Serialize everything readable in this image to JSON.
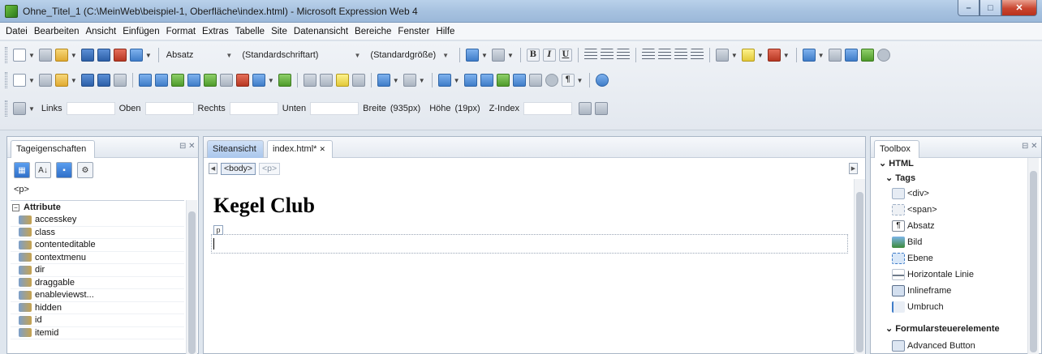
{
  "window": {
    "title": "Ohne_Titel_1 (C:\\MeinWeb\\beispiel-1, Oberfläche\\index.html) - Microsoft Expression Web 4"
  },
  "menu": [
    "Datei",
    "Bearbeiten",
    "Ansicht",
    "Einfügen",
    "Format",
    "Extras",
    "Tabelle",
    "Site",
    "Datenansicht",
    "Bereiche",
    "Fenster",
    "Hilfe"
  ],
  "toolbar": {
    "style_combo": "Absatz",
    "font_combo": "(Standardschriftart)",
    "size_combo": "(Standardgröße)"
  },
  "positioning": {
    "links_label": "Links",
    "oben_label": "Oben",
    "rechts_label": "Rechts",
    "unten_label": "Unten",
    "breite_label": "Breite",
    "breite_value": "(935px)",
    "hoehe_label": "Höhe",
    "hoehe_value": "(19px)",
    "zindex_label": "Z-Index"
  },
  "tag_properties": {
    "tab_title": "Tageigenschaften",
    "current_tag": "<p>",
    "group": "Attribute",
    "attributes": [
      "accesskey",
      "class",
      "contenteditable",
      "contextmenu",
      "dir",
      "draggable",
      "enableviewst...",
      "hidden",
      "id",
      "itemid"
    ]
  },
  "editor": {
    "tabs": [
      "Siteansicht",
      "index.html*"
    ],
    "breadcrumb": [
      "<body>",
      "<p>"
    ],
    "heading": "Kegel Club",
    "p_marker": "p"
  },
  "toolbox": {
    "title": "Toolbox",
    "section_html": "HTML",
    "section_tags": "Tags",
    "tags": [
      "<div>",
      "<span>",
      "Absatz",
      "Bild",
      "Ebene",
      "Horizontale Linie",
      "Inlineframe",
      "Umbruch"
    ],
    "section_forms": "Formularsteuerelemente",
    "form_items": [
      "Advanced Button"
    ]
  }
}
